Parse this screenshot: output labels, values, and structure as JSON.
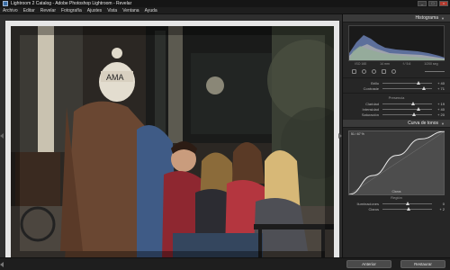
{
  "window": {
    "title": "Lightroom 2 Catalog - Adobe Photoshop Lightroom - Revelar"
  },
  "menu": [
    "Archivo",
    "Editar",
    "Revelar",
    "Fotografía",
    "Ajustes",
    "Vista",
    "Ventana",
    "Ayuda"
  ],
  "photo": {
    "hat_text": "AMA"
  },
  "histogram": {
    "title": "Histograma",
    "info": [
      "ISO 160",
      "14 mm",
      "f / 5.6",
      "1/200 seg"
    ]
  },
  "basic": [
    {
      "label": "Brillo",
      "value": "+ 40",
      "position": 0.72
    },
    {
      "label": "Contraste",
      "value": "+ 71",
      "position": 0.84
    }
  ],
  "presence": {
    "title": "Presencia",
    "sliders": [
      {
        "label": "Claridad",
        "value": "+ 19",
        "position": 0.62
      },
      {
        "label": "Intensidad",
        "value": "+ 40",
        "position": 0.72
      },
      {
        "label": "Saturación",
        "value": "+ 20",
        "position": 0.63
      }
    ]
  },
  "tone_curve": {
    "title": "Curva de tonos",
    "readout": "51 / 67 %",
    "channel": "Claros",
    "curve_points": [
      [
        0,
        0
      ],
      [
        0.25,
        0.3
      ],
      [
        0.5,
        0.62
      ],
      [
        0.75,
        0.88
      ],
      [
        1,
        1
      ]
    ],
    "region_title": "Región",
    "sliders": [
      {
        "label": "Iluminaciones",
        "value": "0",
        "position": 0.5
      },
      {
        "label": "Claros",
        "value": "+ 2",
        "position": 0.52
      }
    ]
  },
  "buttons": {
    "previous": "Anterior",
    "reset": "Restaurar"
  }
}
